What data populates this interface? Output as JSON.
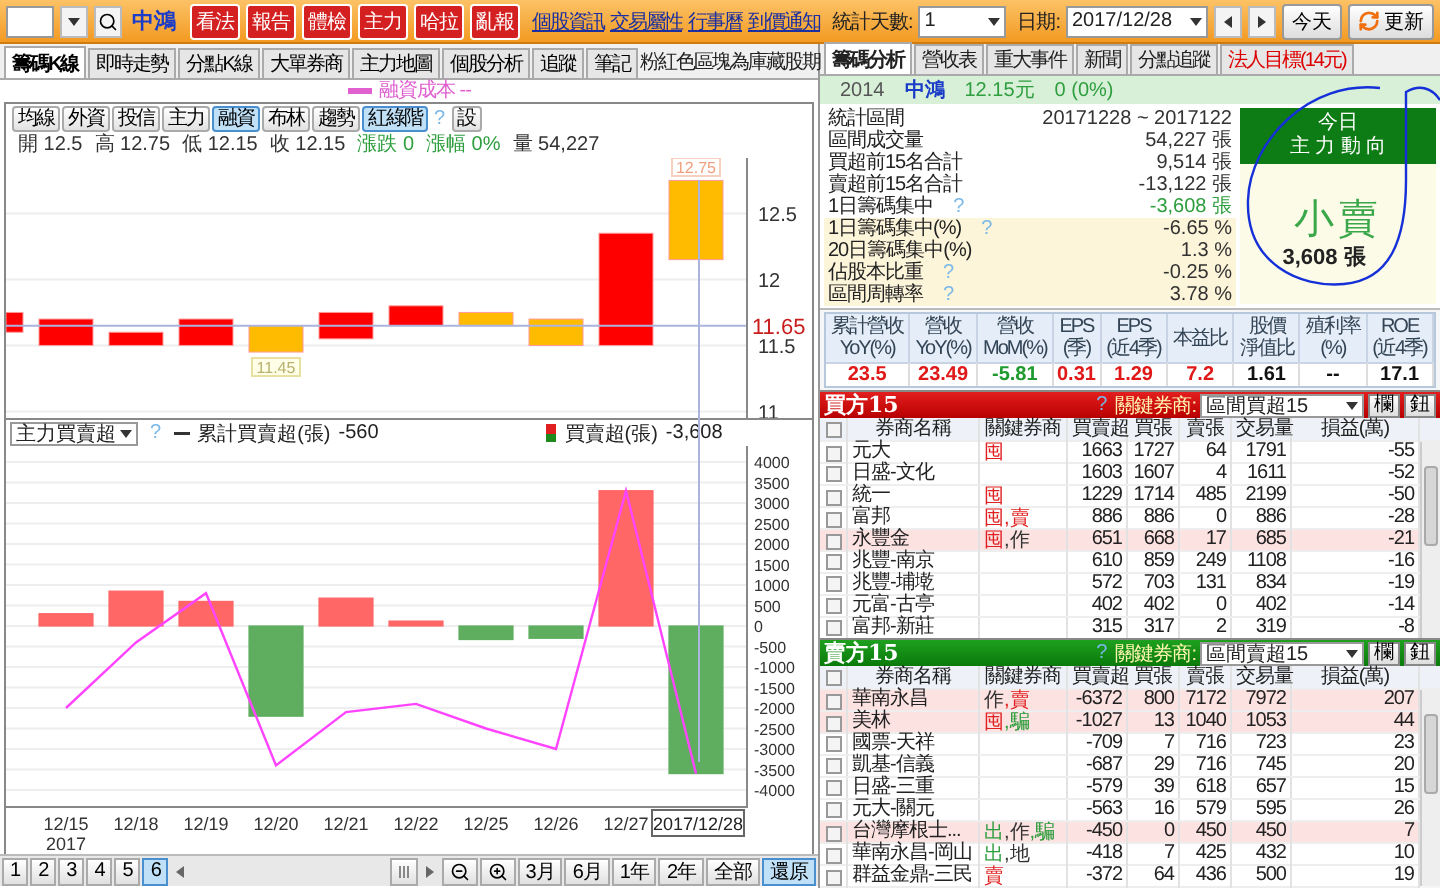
{
  "toolbar": {
    "stock_name": "中鴻",
    "action_buttons": [
      "看法",
      "報告",
      "體檢",
      "主力",
      "哈拉",
      "亂報"
    ],
    "links": [
      "個股資訊",
      "交易屬性",
      "行事曆",
      "到價通知"
    ],
    "days_label": "統計天數:",
    "days_value": "1",
    "date_label": "日期:",
    "date_value": "2017/12/28",
    "today_button": "今天",
    "refresh_button": "更新"
  },
  "left_tabs": [
    {
      "label": "籌碼K線",
      "selected": true
    },
    {
      "label": "即時走勢",
      "selected": false
    },
    {
      "label": "分點K線",
      "selected": false
    },
    {
      "label": "大單券商",
      "selected": false
    },
    {
      "label": "主力地圖",
      "selected": false
    },
    {
      "label": "個股分析",
      "selected": false
    },
    {
      "label": "追蹤",
      "selected": false
    },
    {
      "label": "筆記",
      "selected": false
    }
  ],
  "note": "粉紅色區塊為庫藏股期",
  "legend": "融資成本 --",
  "price_chart": {
    "indicators": [
      {
        "label": "均線",
        "selected": false
      },
      {
        "label": "外資",
        "selected": false
      },
      {
        "label": "投信",
        "selected": false
      },
      {
        "label": "主力",
        "selected": false
      },
      {
        "label": "融資",
        "selected": true
      },
      {
        "label": "布林",
        "selected": false
      },
      {
        "label": "趨勢",
        "selected": false
      },
      {
        "label": "紅綠階",
        "selected": true
      }
    ],
    "help": "?",
    "settings_button": "設",
    "ohlc": [
      {
        "text": "開 12.5",
        "color": "#333333"
      },
      {
        "text": "高 12.75",
        "color": "#333333"
      },
      {
        "text": "低 12.15",
        "color": "#333333"
      },
      {
        "text": "收 12.15",
        "color": "#333333"
      },
      {
        "text": "漲跌 0",
        "color": "#2e9e3e"
      },
      {
        "text": "漲幅 0%",
        "color": "#2e9e3e"
      },
      {
        "text": "量 54,227",
        "color": "#333333"
      }
    ],
    "yticks": [
      "12.5",
      "12",
      "11.5",
      "11"
    ],
    "high_label": "12.75",
    "low_label": "11.45",
    "last_price": "11.65"
  },
  "flow_chart": {
    "selector": "主力買賣超",
    "help": "?",
    "line_value": "-560",
    "bar_value": "-3,608",
    "year_label": "2017",
    "chart_data": {
      "type": "bar",
      "categories": [
        "12/15",
        "12/18",
        "12/19",
        "12/20",
        "12/21",
        "12/22",
        "12/25",
        "12/26",
        "12/27",
        "2017/12/28"
      ],
      "series": [
        {
          "name": "買賣超(張)",
          "type": "bar",
          "color": "#ff6666",
          "values": [
            300,
            850,
            600,
            null,
            680,
            120,
            null,
            null,
            3300,
            null
          ]
        },
        {
          "type": "bar",
          "color": "#5fae5f",
          "values": [
            null,
            null,
            null,
            -2200,
            null,
            null,
            -330,
            -300,
            null,
            -3600
          ]
        },
        {
          "name": "累計買賣超(張)",
          "type": "line",
          "color": "#ff44ff",
          "values": [
            -2000,
            -400,
            800,
            -3400,
            -2100,
            -1900,
            -2500,
            -3000,
            3300,
            -3600
          ]
        }
      ],
      "ylim": [
        -4000,
        4000
      ],
      "stacked": true,
      "grid": true,
      "yticks": [
        4000,
        3500,
        3000,
        2500,
        2000,
        1500,
        1000,
        500,
        0,
        -500,
        -1000,
        -1500,
        -2000,
        -2500,
        -3000,
        -3500,
        -4000
      ]
    }
  },
  "pager": {
    "pages": [
      {
        "label": "1",
        "selected": false
      },
      {
        "label": "2",
        "selected": false
      },
      {
        "label": "3",
        "selected": false
      },
      {
        "label": "4",
        "selected": false
      },
      {
        "label": "5",
        "selected": false
      },
      {
        "label": "6",
        "selected": true
      }
    ],
    "ranges": [
      {
        "label": "3月",
        "selected": false
      },
      {
        "label": "6月",
        "selected": false
      },
      {
        "label": "1年",
        "selected": false
      },
      {
        "label": "2年",
        "selected": false
      },
      {
        "label": "全部",
        "selected": false
      },
      {
        "label": "還原",
        "selected": true
      }
    ]
  },
  "right_tabs": [
    {
      "label": "籌碼分析",
      "selected": true,
      "color": "#222222"
    },
    {
      "label": "營收表",
      "selected": false,
      "color": "#222222"
    },
    {
      "label": "重大事件",
      "selected": false,
      "color": "#222222"
    },
    {
      "label": "新聞",
      "selected": false,
      "color": "#222222"
    },
    {
      "label": "分點追蹤",
      "selected": false,
      "color": "#222222"
    },
    {
      "label": "法人目標(14元)",
      "selected": false,
      "color": "#dd0000"
    }
  ],
  "quote": {
    "code": "2014",
    "name": "中鴻",
    "price": "12.15元",
    "change": "0 (0%)"
  },
  "stats": [
    {
      "label": "統計區間",
      "value": "20171228 ~ 2017122",
      "shaded": false,
      "green": false
    },
    {
      "label": "區間成交量",
      "value": "54,227 張",
      "shaded": false,
      "green": false
    },
    {
      "label": "買超前15名合計",
      "value": "9,514 張",
      "shaded": false,
      "green": false
    },
    {
      "label": "賣超前15名合計",
      "value": "-13,122 張",
      "shaded": false,
      "green": false
    },
    {
      "label": "1日籌碼集中",
      "help": "?",
      "value": "-3,608 張",
      "shaded": false,
      "green": true
    },
    {
      "label": "1日籌碼集中(%)",
      "help": "?",
      "value": "-6.65 %",
      "shaded": true,
      "green": false
    },
    {
      "label": "20日籌碼集中(%)",
      "value": "1.3 %",
      "shaded": true,
      "green": false
    },
    {
      "label": "佔股本比重",
      "help": "?",
      "value": "-0.25 %",
      "shaded": true,
      "green": false
    },
    {
      "label": "區間周轉率",
      "help": "?",
      "value": "3.78 %",
      "shaded": true,
      "green": false
    }
  ],
  "today": {
    "title": "今日",
    "subtitle": "主 力 動 向",
    "verdict": "小賣",
    "amount": "3,608 張"
  },
  "metrics": [
    {
      "label": "累計營收",
      "sub": "YoY(%)",
      "value": "23.5",
      "color": "#e01818"
    },
    {
      "label": "營收",
      "sub": "YoY(%)",
      "value": "23.49",
      "color": "#e01818"
    },
    {
      "label": "營收",
      "sub": "MoM(%)",
      "value": "-5.81",
      "color": "#1e9a2e"
    },
    {
      "label": "EPS",
      "sub": "(季)",
      "value": "0.31",
      "color": "#e01818"
    },
    {
      "label": "EPS",
      "sub": "(近4季)",
      "value": "1.29",
      "color": "#e01818"
    },
    {
      "label": "本益比",
      "value": "7.2",
      "color": "#e01818"
    },
    {
      "label": "股價",
      "sub": "淨值比",
      "value": "1.61",
      "color": "#111111"
    },
    {
      "label": "殖利率",
      "sub": "(%)",
      "value": "--",
      "color": "#111111"
    },
    {
      "label": "ROE",
      "sub": "(近4季)",
      "value": "17.1",
      "color": "#111111"
    }
  ],
  "buy_table": {
    "title": "買方15",
    "help": "?",
    "filter_label": "關鍵券商:",
    "filter_value": "區間買超15",
    "buttons": [
      "欄",
      "鈕"
    ],
    "all_checked": false,
    "columns": [
      "券商名稱",
      "關鍵券商",
      "買賣超",
      "買張",
      "賣張",
      "交易量",
      "損益(萬)"
    ],
    "rows": [
      {
        "cells": [
          "元大",
          {
            "tags": [
              {
                "text": "囤",
                "color": "#e02020"
              }
            ]
          },
          "1663",
          "1727",
          "64",
          "1791",
          "-55"
        ],
        "highlighted": false,
        "checked": false
      },
      {
        "cells": [
          "日盛-文化",
          "",
          "1603",
          "1607",
          "4",
          "1611",
          "-52"
        ],
        "highlighted": false,
        "checked": false
      },
      {
        "cells": [
          "統一",
          {
            "tags": [
              {
                "text": "囤",
                "color": "#e02020"
              }
            ]
          },
          "1229",
          "1714",
          "485",
          "2199",
          "-50"
        ],
        "highlighted": false,
        "checked": false
      },
      {
        "cells": [
          "富邦",
          {
            "tags": [
              {
                "text": "囤",
                "color": "#e02020"
              },
              {
                "text": ",賣",
                "color": "#e02020"
              }
            ]
          },
          "886",
          "886",
          "0",
          "886",
          "-28"
        ],
        "highlighted": false,
        "checked": false
      },
      {
        "cells": [
          "永豐金",
          {
            "tags": [
              {
                "text": "囤",
                "color": "#e02020"
              },
              {
                "text": ",作",
                "color": "#333333"
              }
            ]
          },
          "651",
          "668",
          "17",
          "685",
          "-21"
        ],
        "highlighted": true,
        "checked": false
      },
      {
        "cells": [
          "兆豐-南京",
          "",
          "610",
          "859",
          "249",
          "1108",
          "-16"
        ],
        "highlighted": false,
        "checked": false
      },
      {
        "cells": [
          "兆豐-埔墘",
          "",
          "572",
          "703",
          "131",
          "834",
          "-19"
        ],
        "highlighted": false,
        "checked": false
      },
      {
        "cells": [
          "元富-古亭",
          "",
          "402",
          "402",
          "0",
          "402",
          "-14"
        ],
        "highlighted": false,
        "checked": false
      },
      {
        "cells": [
          "富邦-新莊",
          "",
          "315",
          "317",
          "2",
          "319",
          "-8"
        ],
        "highlighted": false,
        "checked": false
      }
    ]
  },
  "sell_table": {
    "title": "賣方15",
    "help": "?",
    "filter_label": "關鍵券商:",
    "filter_value": "區間賣超15",
    "buttons": [
      "欄",
      "鈕"
    ],
    "all_checked": false,
    "columns": [
      "券商名稱",
      "關鍵券商",
      "買賣超",
      "買張",
      "賣張",
      "交易量",
      "損益(萬)"
    ],
    "rows": [
      {
        "cells": [
          "華南永昌",
          {
            "tags": [
              {
                "text": "作",
                "color": "#333333"
              },
              {
                "text": ",賣",
                "color": "#e02020"
              }
            ]
          },
          "-6372",
          "800",
          "7172",
          "7972",
          "207"
        ],
        "highlighted": true,
        "checked": false
      },
      {
        "cells": [
          "美林",
          {
            "tags": [
              {
                "text": "囤",
                "color": "#e02020"
              },
              {
                "text": ",騙",
                "color": "#2e9e3e"
              }
            ]
          },
          "-1027",
          "13",
          "1040",
          "1053",
          "44"
        ],
        "highlighted": true,
        "checked": false
      },
      {
        "cells": [
          "國票-天祥",
          "",
          "-709",
          "7",
          "716",
          "723",
          "23"
        ],
        "highlighted": false,
        "checked": false
      },
      {
        "cells": [
          "凱基-信義",
          "",
          "-687",
          "29",
          "716",
          "745",
          "20"
        ],
        "highlighted": false,
        "checked": false
      },
      {
        "cells": [
          "日盛-三重",
          "",
          "-579",
          "39",
          "618",
          "657",
          "15"
        ],
        "highlighted": false,
        "checked": false
      },
      {
        "cells": [
          "元大-關元",
          "",
          "-563",
          "16",
          "579",
          "595",
          "26"
        ],
        "highlighted": false,
        "checked": false
      },
      {
        "cells": [
          "台灣摩根士...",
          {
            "tags": [
              {
                "text": "出",
                "color": "#2e9e3e"
              },
              {
                "text": ",作",
                "color": "#333333"
              },
              {
                "text": ",騙",
                "color": "#2e9e3e"
              }
            ]
          },
          "-450",
          "0",
          "450",
          "450",
          "7"
        ],
        "highlighted": true,
        "checked": false
      },
      {
        "cells": [
          "華南永昌-岡山",
          {
            "tags": [
              {
                "text": "出",
                "color": "#2e9e3e"
              },
              {
                "text": ",地",
                "color": "#333333"
              }
            ]
          },
          "-418",
          "7",
          "425",
          "432",
          "10"
        ],
        "highlighted": false,
        "checked": false
      },
      {
        "cells": [
          "群益金鼎-三民",
          {
            "tags": [
              {
                "text": "賣",
                "color": "#e02020"
              }
            ]
          },
          "-372",
          "64",
          "436",
          "500",
          "19"
        ],
        "highlighted": false,
        "checked": false
      }
    ]
  }
}
